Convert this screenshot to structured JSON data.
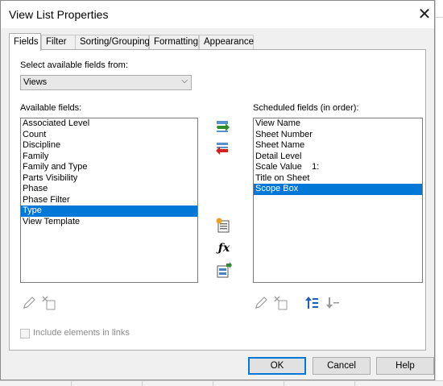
{
  "window": {
    "title": "View List Properties"
  },
  "tabs": [
    {
      "label": "Fields",
      "active": true
    },
    {
      "label": "Filter"
    },
    {
      "label": "Sorting/Grouping"
    },
    {
      "label": "Formatting"
    },
    {
      "label": "Appearance"
    }
  ],
  "fields_tab": {
    "select_from_label": "Select available fields from:",
    "select_from_value": "Views",
    "available_label": "Available fields:",
    "scheduled_label": "Scheduled fields (in order):",
    "available_fields": [
      "Associated Level",
      "Count",
      "Discipline",
      "Family",
      "Family and Type",
      "Parts Visibility",
      "Phase",
      "Phase Filter",
      "Type",
      "View Template"
    ],
    "available_selected": "Type",
    "scheduled_fields": [
      "View Name",
      "Sheet Number",
      "Sheet Name",
      "Detail Level",
      "Scale Value    1:",
      "Title on Sheet",
      "Scope Box"
    ],
    "scheduled_selected": "Scope Box",
    "include_links_label": "Include elements in links",
    "include_links_checked": false
  },
  "buttons": {
    "ok": "OK",
    "cancel": "Cancel",
    "help": "Help"
  },
  "icons": {
    "add": "add-field-icon",
    "remove": "remove-field-icon",
    "new_parameter": "new-parameter-icon",
    "calculated": "fx-icon",
    "combine": "combine-parameters-icon",
    "edit": "edit-pencil-icon",
    "delete": "delete-parameter-icon",
    "move_up": "move-up-icon",
    "move_down": "move-down-icon",
    "close": "close-icon"
  },
  "colors": {
    "selection": "#0078d7",
    "default_button_border": "#0078d7"
  }
}
